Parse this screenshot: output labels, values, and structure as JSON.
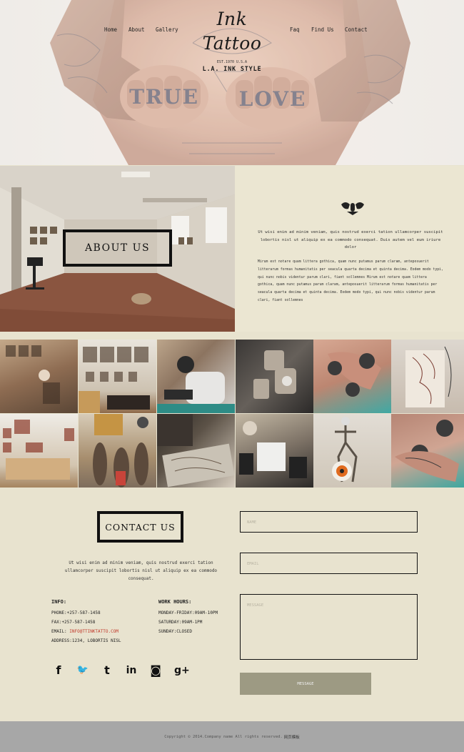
{
  "nav": {
    "left": [
      "Home",
      "About",
      "Gallery"
    ],
    "right": [
      "Faq",
      "Find Us",
      "Contact"
    ]
  },
  "logo": {
    "script": "Ink Tattoo",
    "est": "EST.1970 U.S.A",
    "style": "L.A. INK STYLE"
  },
  "hero": {
    "knuckles_left": "TRUE",
    "knuckles_right": "LOVE"
  },
  "about": {
    "title": "ABOUT US",
    "lead": "Ut wisi enim ad minim veniam, quis nostrud exerci tation ullamcorper suscipit lobortis nisl ut aliquip ex ea commodo consequat. Duis autem vel eum iriure dolor",
    "body": "Mirum est notare quam littera gothica, quam nunc putamus parum claram, anteposuerit litterarum formas humanitatis per seacula quarta decima et quinta decima. Eodem modo typi, qui nunc nobis videntur parum clari, fiant sollemnes Mirum est notare quam littera gothica, quam nunc putamus parum claram, anteposuerit litterarum formas humanitatis per seacula quarta decima et quinta decima. Eodem modo typi, qui nunc nobis videntur parum clari, fiant sollemnes"
  },
  "contact": {
    "title": "CONTACT US",
    "lead": "Ut wisi enim ad minim veniam, quis nostrud exerci tation ullamcorper suscipit lobortis nisl ut aliquip ex ea commodo consequat.",
    "info_heading": "INFO:",
    "phone": "PHONE:+257-587-1458",
    "fax": "FAX:+257-587-1458",
    "email_label": "EMAIL: ",
    "email": "INFO@TTINKTATTO.COM",
    "address": "ADDRESS:1234, LOBORTIS NISL",
    "hours_heading": "WORK HOURS:",
    "hours_weekday": "MONDAY-FRIDAY:09AM-10PM",
    "hours_saturday": "SATURDAY:09AM-1PM",
    "hours_sunday": "SUNDAY:CLOSED"
  },
  "social": {
    "facebook": "f",
    "twitter": "🐦",
    "tumblr": "t",
    "linkedin": "in",
    "instagram": "◙",
    "googleplus": "g+"
  },
  "form": {
    "name_placeholder": "NAME",
    "email_placeholder": "EMAIL",
    "message_placeholder": "MESSAGE",
    "submit_label": "MESSAGE"
  },
  "footer": {
    "text": "Copyright © 2014.Company name All rights reserved.",
    "link": "网页模板"
  },
  "colors": {
    "page_bg": "#e8e3cf",
    "footer_bg": "#a7a7a7",
    "button_bg": "#9d9a83",
    "email_link": "#c0392b"
  }
}
